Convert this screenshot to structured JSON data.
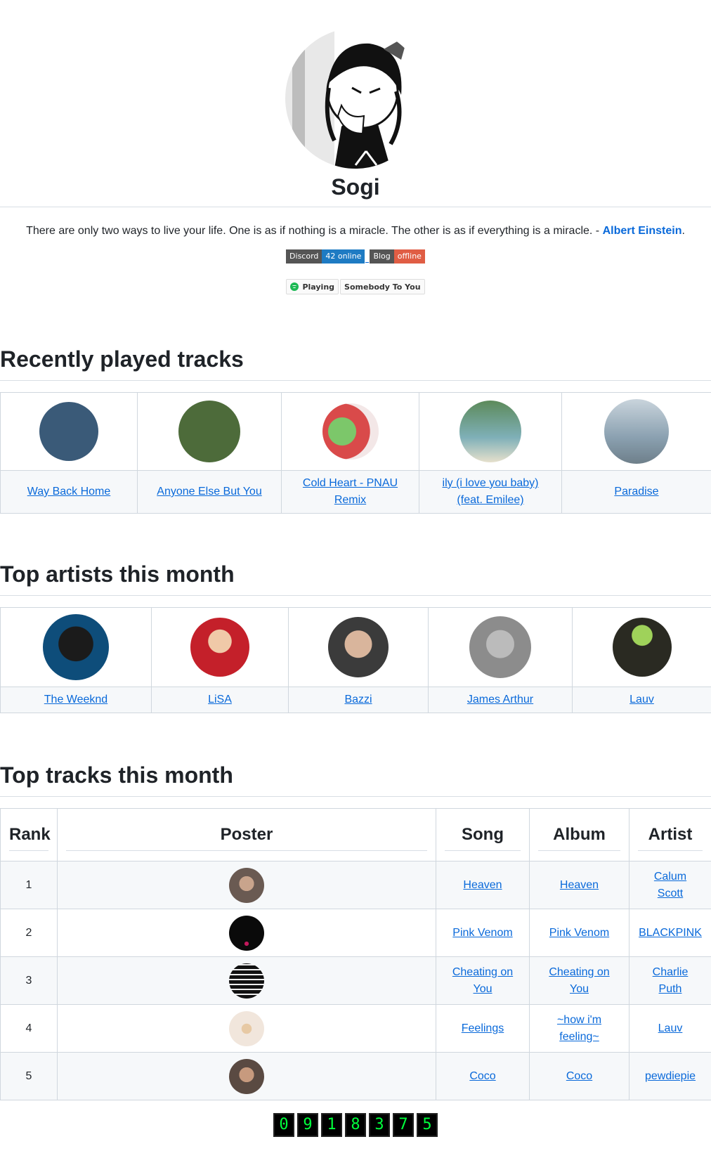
{
  "profile": {
    "name": "Sogi"
  },
  "quote": {
    "text": "There are only two ways to live your life. One is as if nothing is a miracle. The other is as if everything is a miracle. - ",
    "author": "Albert Einstein",
    "end": "."
  },
  "badges": {
    "discord_label": "Discord",
    "discord_value": "42 online",
    "blog_label": "Blog",
    "blog_value": "offline"
  },
  "spotify": {
    "status": "Playing",
    "track": "Somebody To You"
  },
  "recent": {
    "title": "Recently played tracks",
    "tracks": [
      {
        "name": "Way Back Home",
        "color": "#3a5a78"
      },
      {
        "name": "Anyone Else But You",
        "color": "#4d6b3a"
      },
      {
        "name": "Cold Heart - PNAU Remix",
        "color": "#d94a4a"
      },
      {
        "name": "ily (i love you baby) (feat. Emilee)",
        "color": "#7fb0b8"
      },
      {
        "name": "Paradise",
        "color": "#8aa0b0"
      }
    ]
  },
  "artists": {
    "title": "Top artists this month",
    "items": [
      {
        "name": "The Weeknd",
        "color": "#0e4d7a"
      },
      {
        "name": "LiSA",
        "color": "#c4202a"
      },
      {
        "name": "Bazzi",
        "color": "#3b3b3b"
      },
      {
        "name": "James Arthur",
        "color": "#8c8c8c"
      },
      {
        "name": "Lauv",
        "color": "#2a2a22"
      }
    ]
  },
  "top_tracks": {
    "title": "Top tracks this month",
    "headers": {
      "rank": "Rank",
      "poster": "Poster",
      "song": "Song",
      "album": "Album",
      "artist": "Artist"
    },
    "rows": [
      {
        "rank": "1",
        "song": "Heaven",
        "album": "Heaven",
        "artist": "Calum Scott",
        "color": "#6a5a52"
      },
      {
        "rank": "2",
        "song": "Pink Venom",
        "album": "Pink Venom",
        "artist": "BLACKPINK",
        "color": "#0a0a0a"
      },
      {
        "rank": "3",
        "song": "Cheating on You",
        "album": "Cheating on You",
        "artist": "Charlie Puth",
        "color": "#111111"
      },
      {
        "rank": "4",
        "song": "Feelings",
        "album": "~how i'm feeling~",
        "artist": "Lauv",
        "color": "#f1e6dc"
      },
      {
        "rank": "5",
        "song": "Coco",
        "album": "Coco",
        "artist": "pewdiepie",
        "color": "#5a4a42"
      }
    ]
  },
  "counter": {
    "digits": [
      "0",
      "9",
      "1",
      "8",
      "3",
      "7",
      "5"
    ]
  }
}
